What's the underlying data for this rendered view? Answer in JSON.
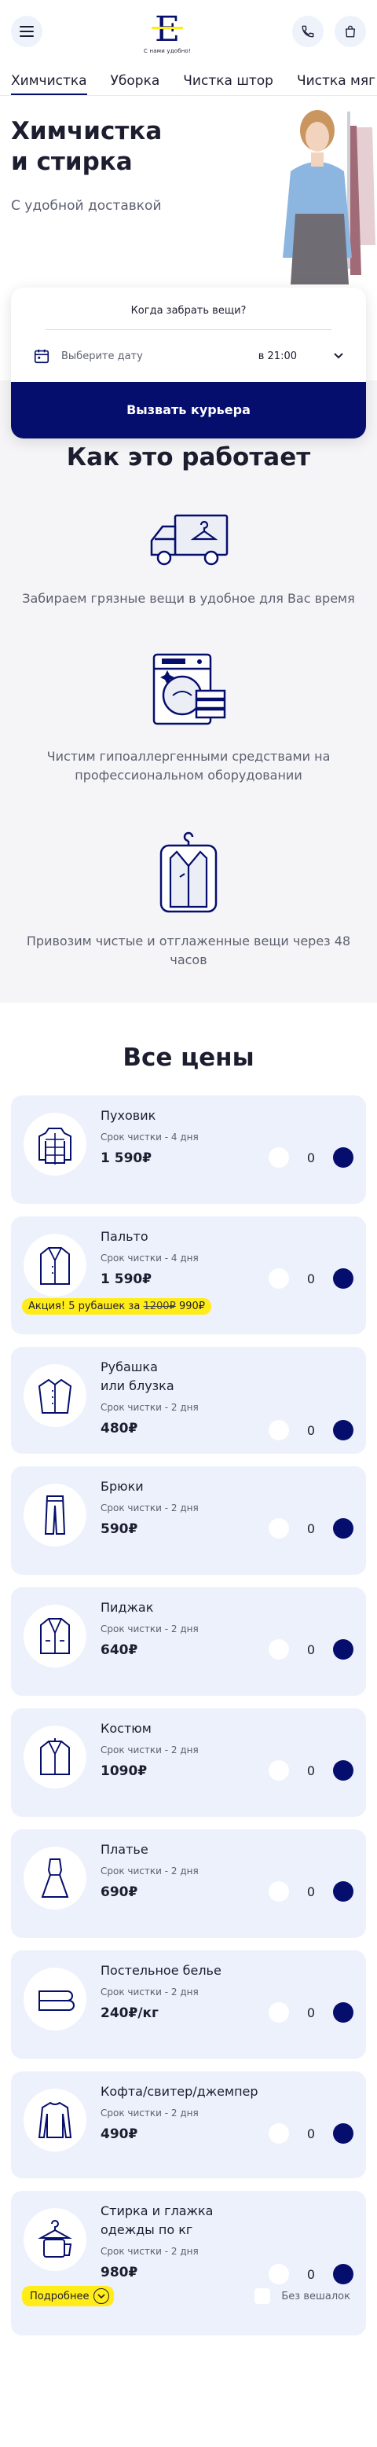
{
  "header": {
    "logo_letter": "E",
    "logo_text": "С нами удобно!"
  },
  "tabs": [
    {
      "label": "Химчистка",
      "active": true
    },
    {
      "label": "Уборка",
      "active": false
    },
    {
      "label": "Чистка штор",
      "active": false
    },
    {
      "label": "Чистка мяг",
      "active": false
    }
  ],
  "hero": {
    "title_line1": "Химчистка",
    "title_line2": "и стирка",
    "subtitle": "С удобной доставкой"
  },
  "order_form": {
    "title": "Когда забрать вещи?",
    "date_placeholder": "Выберите дату",
    "time": "в 21:00",
    "button": "Вызвать курьера"
  },
  "how": {
    "title": "Как это работает",
    "steps": [
      {
        "icon": "delivery-truck-icon",
        "text": "Забираем грязные вещи в удобное для Вас время"
      },
      {
        "icon": "washing-machine-icon",
        "text": "Чистим гипоаллергенными средствами на профессиональном оборудовании"
      },
      {
        "icon": "suit-bag-icon",
        "text": "Привозим чистые и отглаженные вещи через 48 часов"
      }
    ]
  },
  "prices": {
    "title": "Все цены",
    "items": [
      {
        "name": "Пуховик",
        "term": "Срок чистки - 4 дня",
        "price": "1 590₽",
        "qty": "0",
        "icon": "down-jacket-icon"
      },
      {
        "name": "Пальто",
        "term": "Срок чистки - 4 дня",
        "price": "1 590₽",
        "qty": "0",
        "icon": "coat-icon",
        "promo_text": "Акция! 5 рубашек за",
        "promo_old": "1200₽",
        "promo_new": "990₽"
      },
      {
        "name_line1": "Рубашка",
        "name_line2": "или блузка",
        "term": "Срок чистки - 2 дня",
        "price": "480₽",
        "qty": "0",
        "icon": "shirt-icon"
      },
      {
        "name": "Брюки",
        "term": "Срок чистки - 2 дня",
        "price": "590₽",
        "qty": "0",
        "icon": "trousers-icon"
      },
      {
        "name": "Пиджак",
        "term": "Срок чистки - 2 дня",
        "price": "640₽",
        "qty": "0",
        "icon": "jacket-icon"
      },
      {
        "name": "Костюм",
        "term": "Срок чистки - 2 дня",
        "price": "1090₽",
        "qty": "0",
        "icon": "suit-icon"
      },
      {
        "name": "Платье",
        "term": "Срок чистки - 2 дня",
        "price": "690₽",
        "qty": "0",
        "icon": "dress-icon"
      },
      {
        "name": "Постельное белье",
        "term": "Срок чистки - 2 дня",
        "price": "240₽/кг",
        "qty": "0",
        "icon": "bed-linen-icon"
      },
      {
        "name": "Кофта/свитер/джемпер",
        "term": "Срок чистки - 2 дня",
        "price": "490₽",
        "qty": "0",
        "icon": "sweater-icon"
      },
      {
        "name_line1": "Стирка и глажка",
        "name_line2": "одежды по кг",
        "term": "Срок чистки - 2 дня",
        "price": "980₽",
        "qty": "0",
        "icon": "laundry-hanger-icon",
        "more_label": "Подробнее",
        "option_label": "Без вешалок"
      }
    ]
  },
  "colors": {
    "primary": "#060e6d",
    "accent_yellow": "#ffec19",
    "card_bg": "#ecf1fb",
    "section_bg": "#f5f5f7"
  }
}
